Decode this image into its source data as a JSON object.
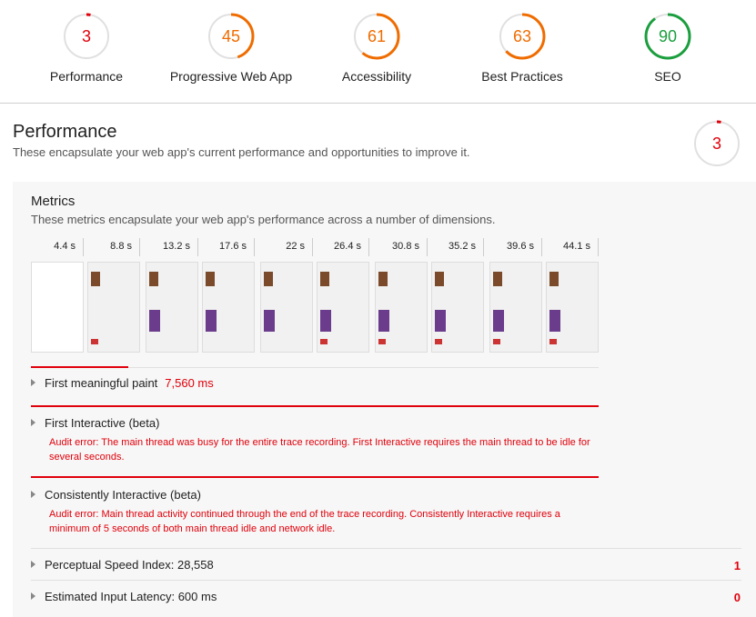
{
  "top_scores": [
    {
      "score": "3",
      "label": "Performance",
      "color": "#e0000b",
      "fraction": 0.03
    },
    {
      "score": "45",
      "label": "Progressive Web App",
      "color": "#ef6c00",
      "fraction": 0.45
    },
    {
      "score": "61",
      "label": "Accessibility",
      "color": "#ef6c00",
      "fraction": 0.61
    },
    {
      "score": "63",
      "label": "Best Practices",
      "color": "#ef6c00",
      "fraction": 0.63
    },
    {
      "score": "90",
      "label": "SEO",
      "color": "#1b9e3e",
      "fraction": 0.9
    }
  ],
  "performance": {
    "title": "Performance",
    "description": "These encapsulate your web app's current performance and opportunities to improve it.",
    "score": "3",
    "score_fraction": 0.03
  },
  "metrics": {
    "title": "Metrics",
    "description": "These metrics encapsulate your web app's performance across a number of dimensions.",
    "filmstrip_times": [
      "4.4 s",
      "8.8 s",
      "13.2 s",
      "17.6 s",
      "22 s",
      "26.4 s",
      "30.8 s",
      "35.2 s",
      "39.6 s",
      "44.1 s"
    ]
  },
  "audits": {
    "fmp": {
      "label": "First meaningful paint",
      "value": "7,560 ms"
    },
    "first_interactive": {
      "label": "First Interactive (beta)",
      "error": "Audit error: The main thread was busy for the entire trace recording. First Interactive requires the main thread to be idle for several seconds."
    },
    "consistently_interactive": {
      "label": "Consistently Interactive (beta)",
      "error": "Audit error: Main thread activity continued through the end of the trace recording. Consistently Interactive requires a minimum of 5 seconds of both main thread idle and network idle."
    },
    "psi": {
      "label": "Perceptual Speed Index: 28,558",
      "score": "1"
    },
    "eil": {
      "label": "Estimated Input Latency: 600 ms",
      "score": "0"
    }
  }
}
